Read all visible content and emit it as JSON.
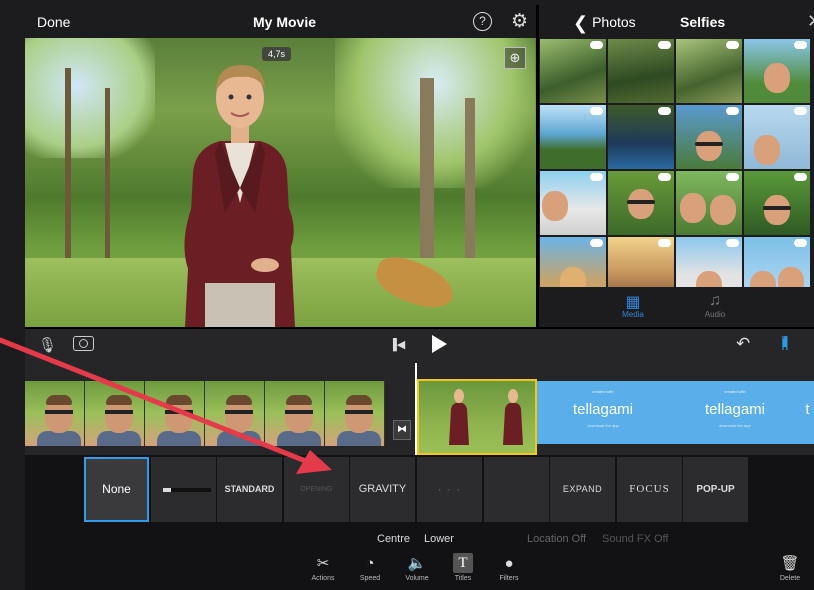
{
  "topbar": {
    "done_label": "Done",
    "title": "My Movie",
    "help_icon": "?",
    "settings_icon": "gear-icon"
  },
  "preview": {
    "duration": "4,7s"
  },
  "library": {
    "back_label": "Photos",
    "title": "Selfies",
    "tabs": [
      {
        "label": "Media",
        "icon": "film-icon",
        "active": true
      },
      {
        "label": "Audio",
        "icon": "music-note-icon",
        "active": false
      }
    ]
  },
  "timeline": {
    "clip3_small_text": "created with",
    "clip3_logo": "tellagami",
    "clip3_sub": "download the app",
    "clip3_logo_2": "tellagami",
    "clip3_small_text_2": "created with",
    "clip3_sub_2": "download the app",
    "clip3_logo_3": "t"
  },
  "title_styles": [
    {
      "label": "None",
      "selected": true
    },
    {
      "label": "",
      "selected": false
    },
    {
      "label": "STANDARD",
      "selected": false
    },
    {
      "label": "OPENING",
      "selected": false
    },
    {
      "label": "GRAVITY",
      "selected": false
    },
    {
      "label": "· · ·",
      "selected": false
    },
    {
      "label": "",
      "selected": false
    },
    {
      "label": "EXPAND",
      "selected": false
    },
    {
      "label": "FOCUS",
      "selected": false
    },
    {
      "label": "POP-UP",
      "selected": false
    }
  ],
  "title_options": {
    "centre": "Centre",
    "lower": "Lower",
    "location": "Location Off",
    "sound": "Sound FX Off"
  },
  "tools": {
    "actions": "Actions",
    "speed": "Speed",
    "volume": "Volume",
    "titles": "Titles",
    "filters": "Filters",
    "delete": "Delete",
    "titles_glyph": "T"
  },
  "colors": {
    "accent": "#2f9be9",
    "clip_border": "#f5c518",
    "tellagami_blue": "#5aaee9",
    "annotation_arrow": "#e53a4a"
  }
}
